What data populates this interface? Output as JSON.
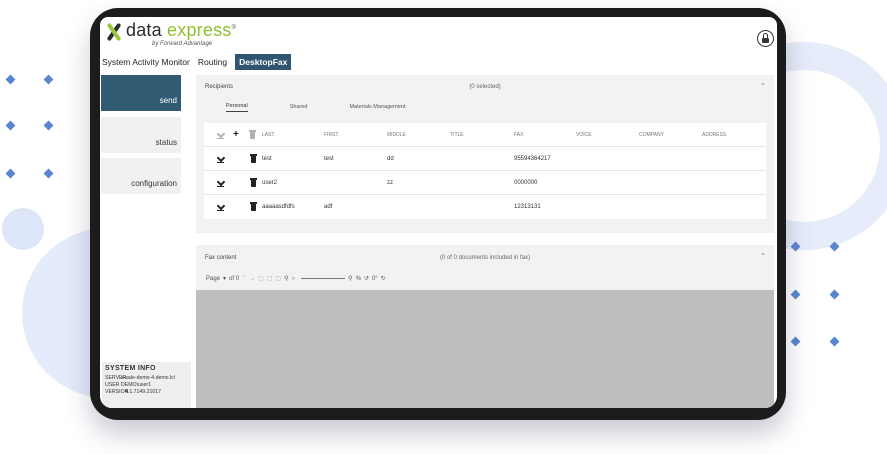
{
  "app": {
    "logo_word1": "data",
    "logo_word2": "express",
    "logo_reg": "®",
    "logo_tagline": "by Forward Advantage"
  },
  "topnav": {
    "items": [
      {
        "label": "System Activity Monitor"
      },
      {
        "label": "Routing"
      },
      {
        "label": "DesktopFax",
        "active": true
      }
    ]
  },
  "sidebar": {
    "items": [
      {
        "label": "send",
        "active": true
      },
      {
        "label": "status"
      },
      {
        "label": "configuration"
      }
    ]
  },
  "system_info": {
    "title": "SYSTEM INFO",
    "server_label": "SERVER",
    "server_value": "s-sale-demo-4.demo.lcl",
    "user_label": "USER",
    "user_value": "DEMO\\user1",
    "version_label": "VERSION",
    "version_value": "4.1.7149.21017"
  },
  "recipients": {
    "title": "Recipients",
    "selected": "(0 selected)",
    "tabs": [
      "Personal",
      "Shared",
      "Materials Management"
    ],
    "columns": [
      "LAST",
      "FIRST",
      "MIDDLE",
      "TITLE",
      "FAX",
      "VOICE",
      "COMPANY",
      "ADDRESS"
    ],
    "rows": [
      {
        "last": "test",
        "first": "test",
        "middle": "dd",
        "title": "",
        "fax": "95594364217",
        "voice": "",
        "company": "",
        "address": ""
      },
      {
        "last": "user2",
        "first": "",
        "middle": "zz",
        "title": "",
        "fax": "0000000",
        "voice": "",
        "company": "",
        "address": ""
      },
      {
        "last": "aaaaasdfdfs",
        "first": "adf",
        "middle": "",
        "title": "",
        "fax": "12313131",
        "voice": "",
        "company": "",
        "address": ""
      }
    ]
  },
  "fax_content": {
    "title": "Fax content",
    "included": "(0 of 0 documents included in fax)",
    "page_label": "Page",
    "page_of": "of 0",
    "zoom_value": "%",
    "rotate_value": "0°"
  },
  "colors": {
    "accent": "#315a73",
    "logo_green": "#8fbf2e",
    "deco_blue": "#5a85cf"
  }
}
